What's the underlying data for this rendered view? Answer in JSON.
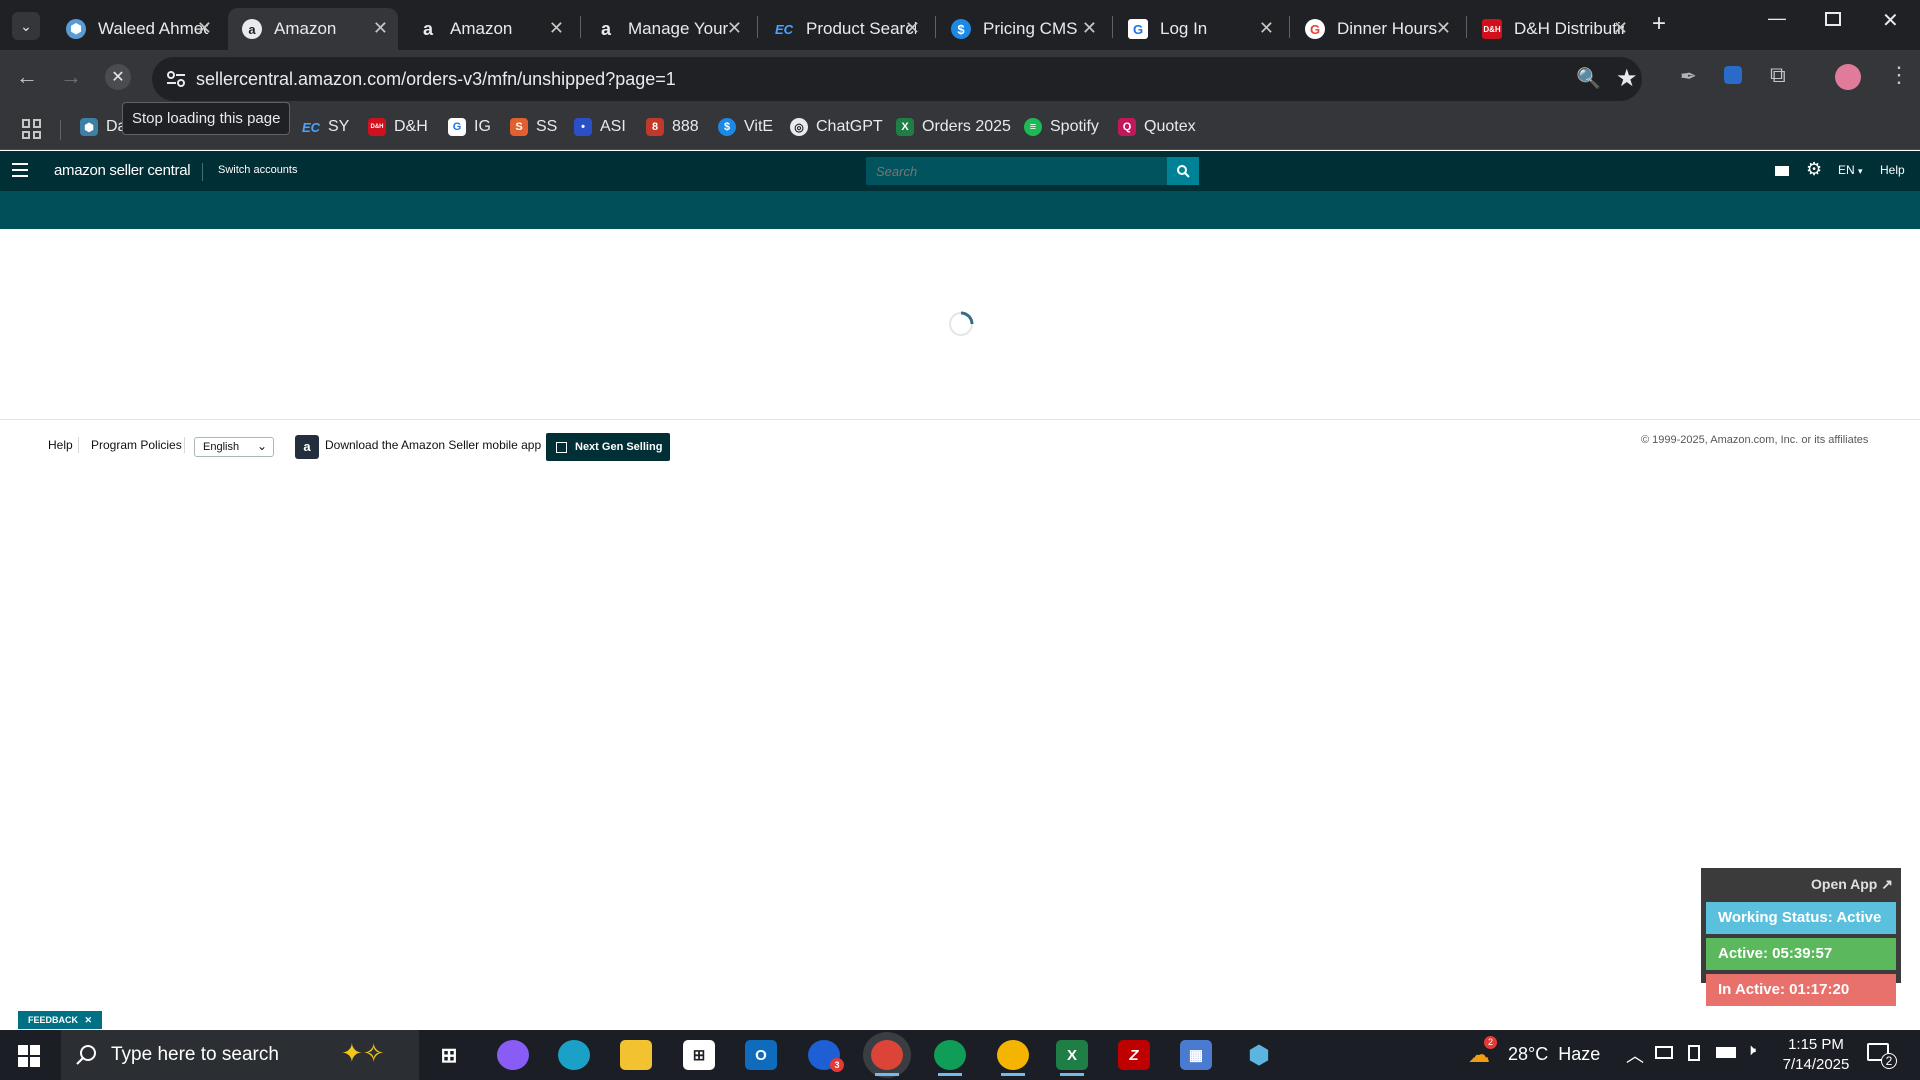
{
  "browser": {
    "tabs": [
      {
        "title": "Waleed Ahmed",
        "icon": "hexagon-icon",
        "active": false
      },
      {
        "title": "Amazon",
        "icon": "amazon-icon",
        "active": true
      },
      {
        "title": "Amazon",
        "icon": "amazon-icon",
        "active": false
      },
      {
        "title": "Manage Your",
        "icon": "amazon-icon",
        "active": false
      },
      {
        "title": "Product Search",
        "icon": "ec-icon",
        "active": false
      },
      {
        "title": "Pricing CMS",
        "icon": "dollar-icon",
        "active": false
      },
      {
        "title": "Log In",
        "icon": "g-icon",
        "active": false
      },
      {
        "title": "Dinner Hours",
        "icon": "google-icon",
        "active": false
      },
      {
        "title": "D&H Distributing",
        "icon": "dh-icon",
        "active": false
      }
    ],
    "url": "sellercentral.amazon.com/orders-v3/mfn/unshipped?page=1",
    "tooltip": "Stop loading this page",
    "bookmarks": [
      {
        "label": "Da",
        "color": "#3e7fa5"
      },
      {
        "label": "SY",
        "icon_text": "EC",
        "color": "#1a73e8"
      },
      {
        "label": "D&H",
        "icon_text": "D&H",
        "color": "#d0101d"
      },
      {
        "label": "IG",
        "icon_text": "G",
        "color": "#1a73e8"
      },
      {
        "label": "SS",
        "icon_text": "S",
        "color": "#e06030"
      },
      {
        "label": "ASI",
        "icon_text": "•",
        "color": "#2a50c8"
      },
      {
        "label": "888",
        "icon_text": "8",
        "color": "#c0392b"
      },
      {
        "label": "VitE",
        "icon_text": "$",
        "color": "#1e88e5"
      },
      {
        "label": "ChatGPT",
        "icon_text": "◎",
        "color": "#3c3c3c"
      },
      {
        "label": "Orders 2025",
        "icon_text": "X",
        "color": "#1e7e45"
      },
      {
        "label": "Spotify",
        "icon_text": "≡",
        "color": "#1db954"
      },
      {
        "label": "Quotex",
        "icon_text": "Q",
        "color": "#c2185b"
      }
    ]
  },
  "seller_central": {
    "logo": "amazon seller central",
    "switch_accounts": "Switch accounts",
    "search_placeholder": "Search",
    "language": "EN",
    "help": "Help"
  },
  "footer": {
    "help": "Help",
    "program_policies": "Program Policies",
    "language_select": "English",
    "download_app": "Download the Amazon Seller mobile app",
    "next_gen": "Next Gen Selling",
    "copyright": "© 1999-2025, Amazon.com, Inc. or its affiliates"
  },
  "feedback": "FEEDBACK",
  "widget": {
    "open_app": "Open App ↗",
    "working_status": "Working Status: Active",
    "active": "Active: 05:39:57",
    "inactive": "In Active: 01:17:20",
    "colors": {
      "status": "#5bc0de",
      "active": "#5cb85c",
      "inactive": "#e8716b"
    }
  },
  "taskbar": {
    "search_placeholder": "Type here to search",
    "weather": "28°C  Haze",
    "weather_badge": "2",
    "time": "1:15 PM",
    "date": "7/14/2025",
    "notifications": "2",
    "outlook_badge": "3"
  }
}
